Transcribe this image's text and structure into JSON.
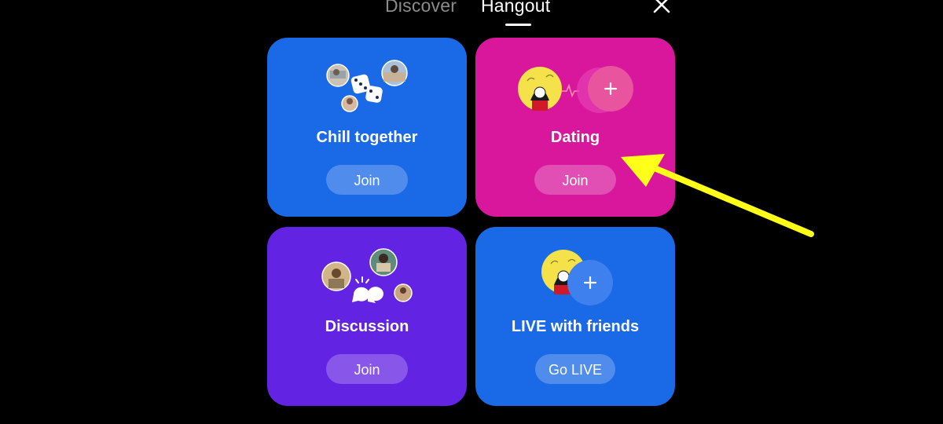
{
  "tabs": {
    "discover": "Discover",
    "hangout": "Hangout",
    "active": "Hangout"
  },
  "cards": {
    "chill": {
      "title": "Chill together",
      "button": "Join"
    },
    "dating": {
      "title": "Dating",
      "button": "Join"
    },
    "discussion": {
      "title": "Discussion",
      "button": "Join"
    },
    "live": {
      "title": "LIVE with friends",
      "button": "Go LIVE"
    }
  },
  "icons": {
    "close": "close-icon",
    "dice": "dice-icon",
    "heartbeat": "heartbeat-icon",
    "plus": "plus-icon",
    "chat_bubbles": "chat-bubbles-icon"
  },
  "colors": {
    "background": "#000000",
    "chill_card": "#1a69e6",
    "dating_card": "#d8179d",
    "discussion_card": "#6323e2",
    "live_card": "#1a69e6",
    "annotation_arrow": "#ffff1a"
  }
}
